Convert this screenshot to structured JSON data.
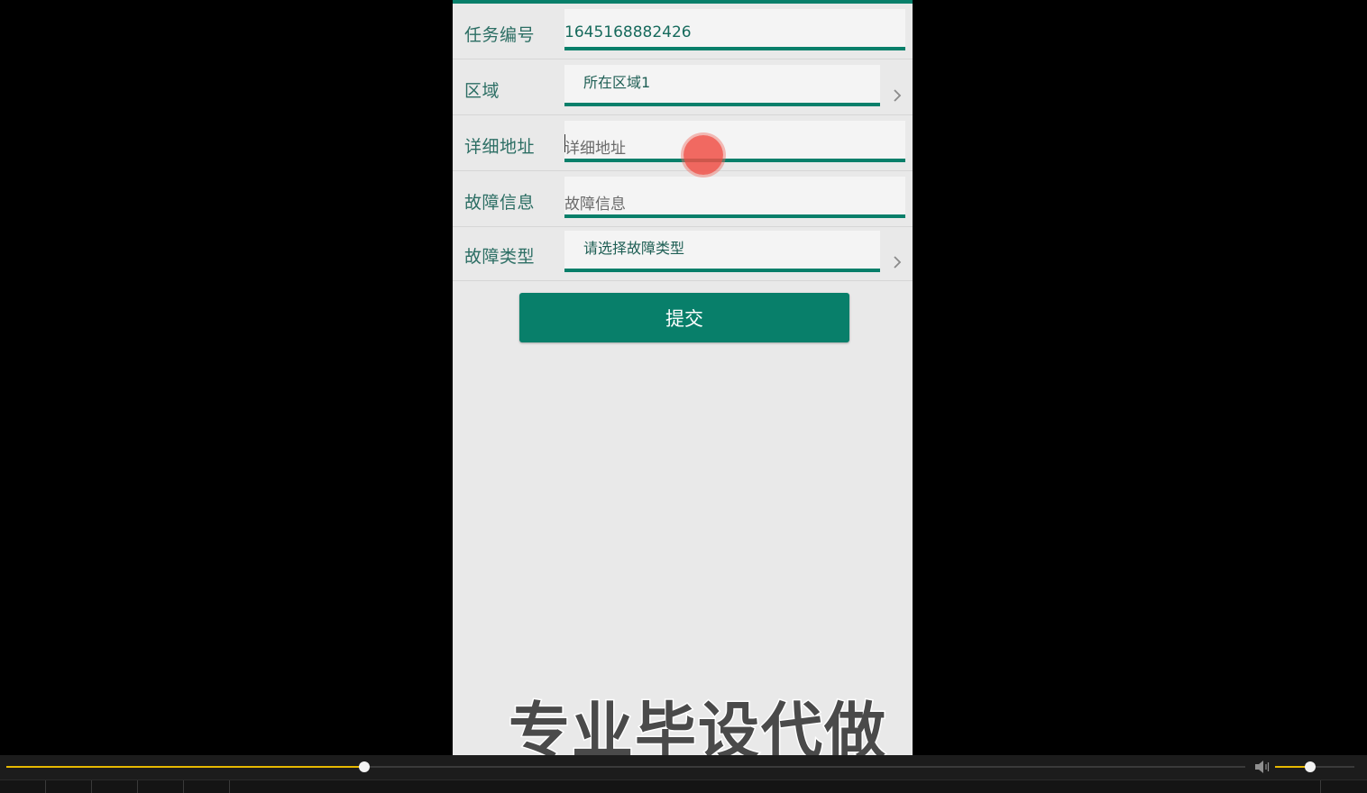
{
  "form": {
    "rows": [
      {
        "label": "任务编号",
        "value": "1645168882426",
        "kind": "value"
      },
      {
        "label": "区域",
        "value": "所在区域1",
        "kind": "select"
      },
      {
        "label": "详细地址",
        "placeholder": "详细地址",
        "kind": "input"
      },
      {
        "label": "故障信息",
        "placeholder": "故障信息",
        "kind": "input"
      },
      {
        "label": "故障类型",
        "value": "请选择故障类型",
        "kind": "select"
      }
    ],
    "submit_label": "提交"
  },
  "watermark": "专业毕设代做",
  "player": {
    "progress": 0.289,
    "volume": 0.44
  },
  "colors": {
    "accent": "#087f6a",
    "player_accent": "#e6b800",
    "touch": "#f05046"
  },
  "icons": {
    "chevron": "chevron-right-icon",
    "volume": "volume-icon"
  }
}
